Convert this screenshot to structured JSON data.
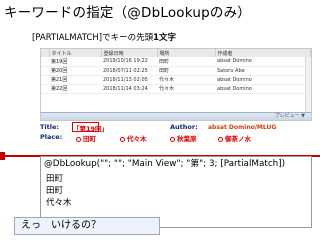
{
  "slide": {
    "title": "キーワードの指定（@DbLookupのみ）",
    "subtitle_prefix": "[PARTIALMATCH]でキーの先頭",
    "subtitle_bold": "1文字"
  },
  "view": {
    "columns": [
      "タイトル",
      "登録日時",
      "場所",
      "作成者"
    ],
    "rows": [
      {
        "title": "第19回",
        "date": "2019/10/16 19:22",
        "place": "田町",
        "author": "absat Domino"
      },
      {
        "title": "第20回",
        "date": "2018/07/11 02:25",
        "place": "田町",
        "author": "Satoru Abe"
      },
      {
        "title": "第21回",
        "date": "2018/11/13 02:05",
        "place": "代々木",
        "author": "absat Domino"
      },
      {
        "title": "第22回",
        "date": "2018/11/14 03:24",
        "place": "代々木",
        "author": "absat Domino"
      }
    ],
    "preview_label": "プレビュー ▼"
  },
  "form": {
    "title_label": "Title:",
    "title_value": "「第19回」",
    "author_label": "Author:",
    "author_value": "absat Domino/MLUG",
    "place_label": "Place:",
    "places": [
      "田町",
      "代々木",
      "秋葉原",
      "御茶ノ水"
    ]
  },
  "formula": "@DbLookup(\"\"; \"\"; \"Main View\"; \"第\"; 3; [PartialMatch])",
  "results": [
    "田町",
    "田町",
    "代々木"
  ],
  "speech": "えっ　いけるの？",
  "colors": {
    "accent_red": "#e00000",
    "label_blue": "#0a2a7a"
  }
}
